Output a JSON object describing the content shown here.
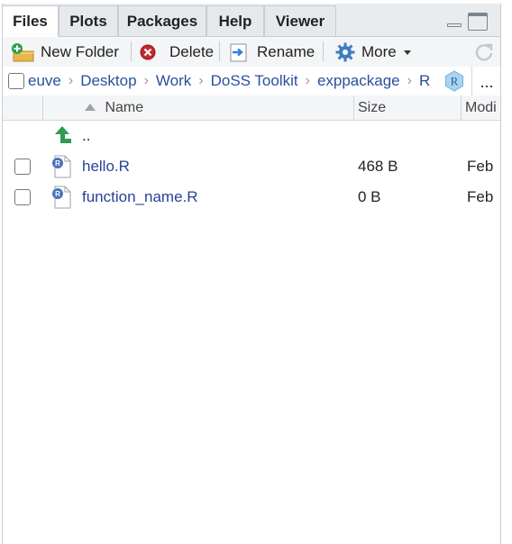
{
  "tabs": [
    {
      "label": "Files",
      "active": true
    },
    {
      "label": "Plots",
      "active": false
    },
    {
      "label": "Packages",
      "active": false
    },
    {
      "label": "Help",
      "active": false
    },
    {
      "label": "Viewer",
      "active": false
    }
  ],
  "toolbar": {
    "new_folder": "New Folder",
    "delete": "Delete",
    "rename": "Rename",
    "more": "More"
  },
  "breadcrumb": {
    "items": [
      "euve",
      "Desktop",
      "Work",
      "DoSS Toolkit",
      "exppackage",
      "R"
    ],
    "overflow": "..."
  },
  "table": {
    "columns": {
      "name": "Name",
      "size": "Size",
      "modified": "Modi"
    },
    "parent": "..",
    "rows": [
      {
        "name": "hello.R",
        "size": "468 B",
        "modified": "Feb"
      },
      {
        "name": "function_name.R",
        "size": "0 B",
        "modified": "Feb"
      }
    ]
  },
  "colors": {
    "link": "#2a3f9a",
    "up_arrow": "#2e9d4f",
    "r_badge": "#4b73b8"
  }
}
